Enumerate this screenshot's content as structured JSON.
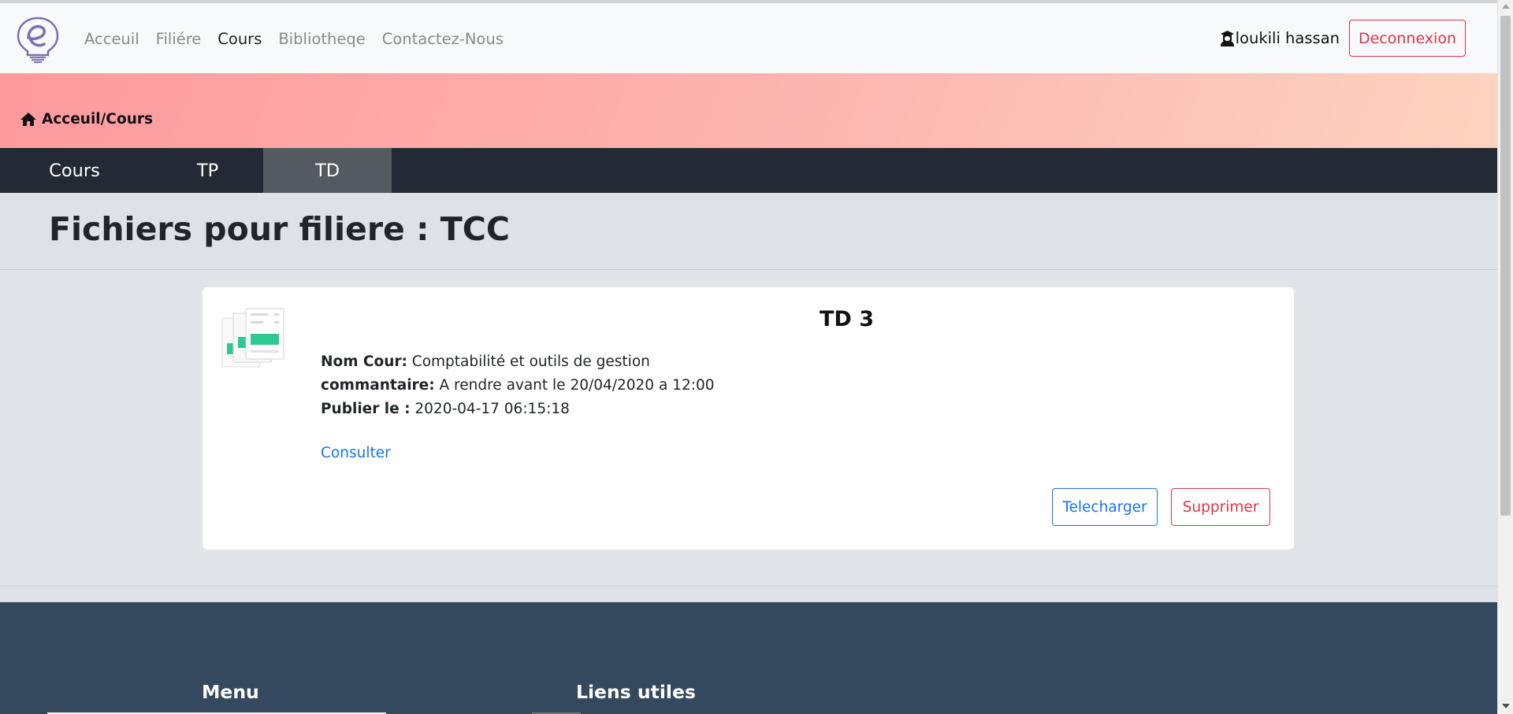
{
  "navbar": {
    "logo_icon": "lightbulb-e-logo",
    "links": [
      {
        "label": "Acceuil",
        "active": false
      },
      {
        "label": "Filiére",
        "active": false
      },
      {
        "label": "Cours",
        "active": true
      },
      {
        "label": "Bibliotheqe",
        "active": false
      },
      {
        "label": "Contactez-Nous",
        "active": false
      }
    ],
    "user_icon": "graduate-icon",
    "user_name": "loukili hassan",
    "logout_label": "Deconnexion"
  },
  "banner": {
    "home_icon": "home-icon",
    "breadcrumb": "Acceuil/Cours"
  },
  "tabs": [
    {
      "label": "Cours",
      "active": false
    },
    {
      "label": "TP",
      "active": false
    },
    {
      "label": "TD",
      "active": true
    }
  ],
  "page": {
    "title": "Fichiers pour filiere : TCC"
  },
  "card": {
    "file_icon": "documents-icon",
    "title": "TD 3",
    "fields": [
      {
        "label": "Nom Cour:",
        "value": "Comptabilité et outils de gestion"
      },
      {
        "label": "commantaire:",
        "value": "A rendre avant le 20/04/2020 a 12:00"
      },
      {
        "label": "Publier le :",
        "value": "2020-04-17 06:15:18"
      }
    ],
    "consult_label": "Consulter",
    "download_label": "Telecharger",
    "delete_label": "Supprimer"
  },
  "footer": {
    "menu_heading": "Menu",
    "links_heading": "Liens utiles"
  },
  "colors": {
    "danger": "#dc3545",
    "primary": "#1a73e8",
    "tabbar": "#232a35",
    "footer": "#34495e",
    "file_green": "#2ec98e"
  }
}
